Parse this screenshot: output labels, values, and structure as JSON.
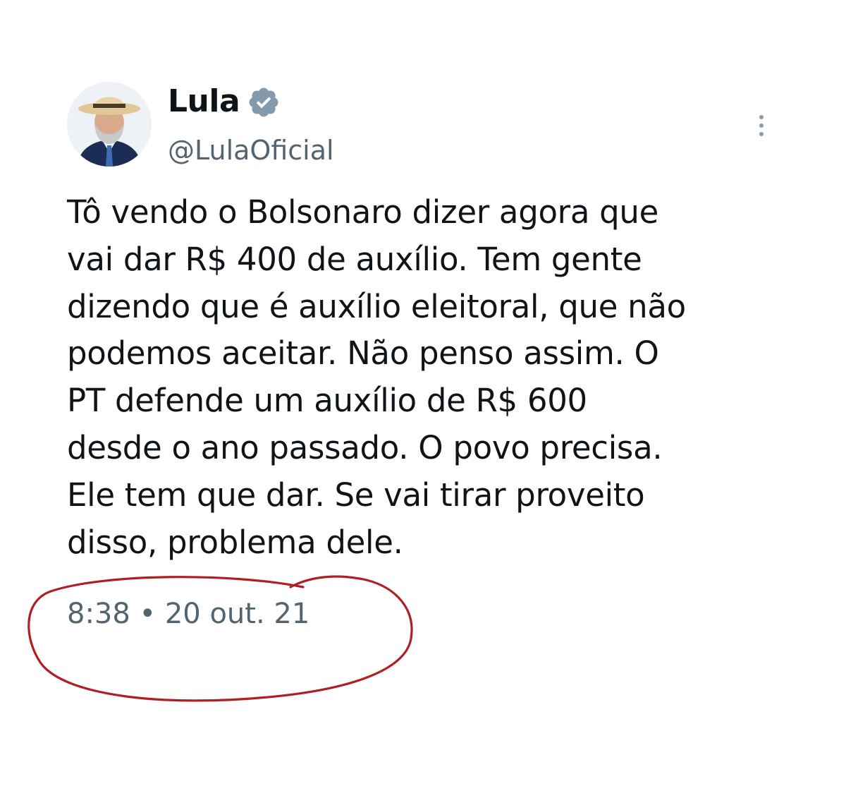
{
  "tweet": {
    "author": {
      "display_name": "Lula",
      "handle": "@LulaOficial",
      "verified": true,
      "avatar_icon": "avatar-photo"
    },
    "text": "Tô vendo o Bolsonaro dizer agora que\nvai dar R$ 400 de auxílio. Tem gente\ndizendo que é auxílio eleitoral, que não\npodemos aceitar. Não penso assim. O\nPT defende um auxílio de R$ 600\ndesde o ano passado. O povo precisa.\nEle tem que dar. Se vai tirar proveito\ndisso, problema dele.",
    "timestamp": "8:38 • 20 out. 21",
    "more_icon": "more-vertical-icon"
  },
  "colors": {
    "text": "#0f1419",
    "secondary_text": "#536471",
    "verified_badge": "#829aab",
    "annotation_circle": "#b01e23"
  }
}
